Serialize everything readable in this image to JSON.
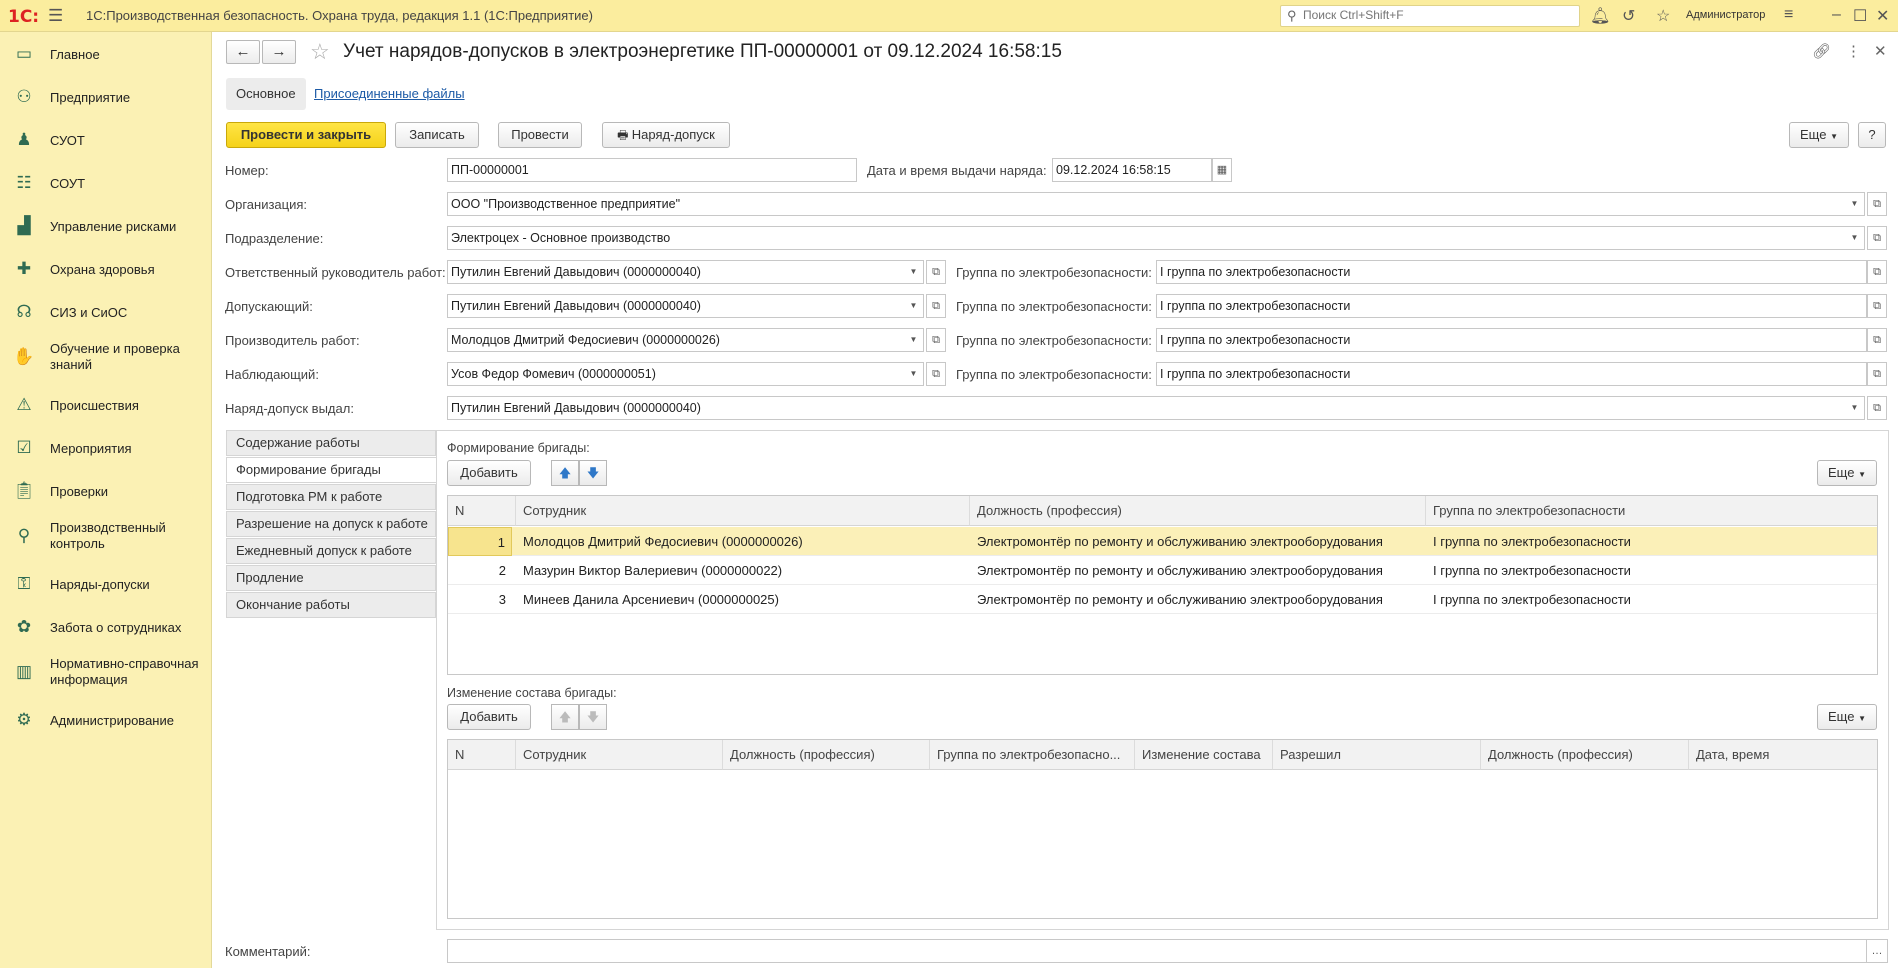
{
  "app": {
    "logo": "1С:",
    "title": "1С:Производственная безопасность. Охрана труда, редакция 1.1  (1С:Предприятие)",
    "search_placeholder": "Поиск Ctrl+Shift+F",
    "user": "Администратор"
  },
  "sidebar": {
    "items": [
      {
        "label": "Главное",
        "icon": "monitor-icon"
      },
      {
        "label": "Предприятие",
        "icon": "org-chart-icon"
      },
      {
        "label": "СУОТ",
        "icon": "worker-icon"
      },
      {
        "label": "СОУТ",
        "icon": "checklist-icon"
      },
      {
        "label": "Управление рисками",
        "icon": "risk-chart-icon"
      },
      {
        "label": "Охрана здоровья",
        "icon": "medical-cross-icon"
      },
      {
        "label": "СИЗ и СиОС",
        "icon": "headphones-icon"
      },
      {
        "label": "Обучение и проверка знаний",
        "icon": "hand-book-icon"
      },
      {
        "label": "Происшествия",
        "icon": "warning-icon"
      },
      {
        "label": "Мероприятия",
        "icon": "tasks-icon"
      },
      {
        "label": "Проверки",
        "icon": "clipboard-icon"
      },
      {
        "label": "Производственный контроль",
        "icon": "magnifier-icon"
      },
      {
        "label": "Наряды-допуски",
        "icon": "permit-icon"
      },
      {
        "label": "Забота о сотрудниках",
        "icon": "care-icon"
      },
      {
        "label": "Нормативно-справочная информация",
        "icon": "books-icon"
      },
      {
        "label": "Администрирование",
        "icon": "admin-icon"
      }
    ]
  },
  "doc": {
    "title": "Учет нарядов-допусков в электроэнергетике ПП-00000001 от 09.12.2024 16:58:15"
  },
  "tabs": {
    "main": "Основное",
    "files": "Присоединенные файлы"
  },
  "toolbar": {
    "post_close": "Провести и закрыть",
    "save": "Записать",
    "post": "Провести",
    "print": "Наряд-допуск",
    "more": "Еще",
    "help": "?"
  },
  "form": {
    "number_label": "Номер:",
    "number": "ПП-00000001",
    "date_label": "Дата и время выдачи наряда:",
    "date": "09.12.2024 16:58:15",
    "org_label": "Организация:",
    "org": "ООО \"Производственное предприятие\"",
    "dept_label": "Подразделение:",
    "dept": "Электроцех - Основное производство",
    "group_label": "Группа по электробезопасности:",
    "people": [
      {
        "label": "Ответственный руководитель работ:",
        "value": "Путилин Евгений Давыдович (0000000040)",
        "group": "I группа по электробезопасности"
      },
      {
        "label": "Допускающий:",
        "value": "Путилин Евгений Давыдович (0000000040)",
        "group": "I группа по электробезопасности"
      },
      {
        "label": "Производитель работ:",
        "value": "Молодцов Дмитрий Федосиевич (0000000026)",
        "group": "I группа по электробезопасности"
      },
      {
        "label": "Наблюдающий:",
        "value": "Усов Федор Фомевич (0000000051)",
        "group": "I группа по электробезопасности"
      }
    ],
    "issued_label": "Наряд-допуск выдал:",
    "issued": "Путилин Евгений Давыдович (0000000040)",
    "comment_label": "Комментарий:",
    "comment": ""
  },
  "vtabs": [
    "Содержание работы",
    "Формирование бригады",
    "Подготовка РМ к работе",
    "Разрешение на допуск к работе",
    "Ежедневный допуск к работе",
    "Продление",
    "Окончание работы"
  ],
  "brigade": {
    "title": "Формирование бригады:",
    "add": "Добавить",
    "more": "Еще",
    "columns": [
      "N",
      "Сотрудник",
      "Должность (профессия)",
      "Группа по электробезопасности"
    ],
    "rows": [
      [
        "1",
        "Молодцов Дмитрий Федосиевич (0000000026)",
        "Электромонтёр по ремонту и обслуживанию электрооборудования",
        "I группа по электробезопасности"
      ],
      [
        "2",
        "Мазурин Виктор Валериевич (0000000022)",
        "Электромонтёр по ремонту и обслуживанию электрооборудования",
        "I группа по электробезопасности"
      ],
      [
        "3",
        "Минеев Данила Арсениевич (0000000025)",
        "Электромонтёр по ремонту и обслуживанию электрооборудования",
        "I группа по электробезопасности"
      ]
    ]
  },
  "changes": {
    "title": "Изменение состава бригады:",
    "add": "Добавить",
    "more": "Еще",
    "columns": [
      "N",
      "Сотрудник",
      "Должность (профессия)",
      "Группа по электробезопасно...",
      "Изменение состава",
      "Разрешил",
      "Должность (профессия)",
      "Дата, время"
    ]
  }
}
